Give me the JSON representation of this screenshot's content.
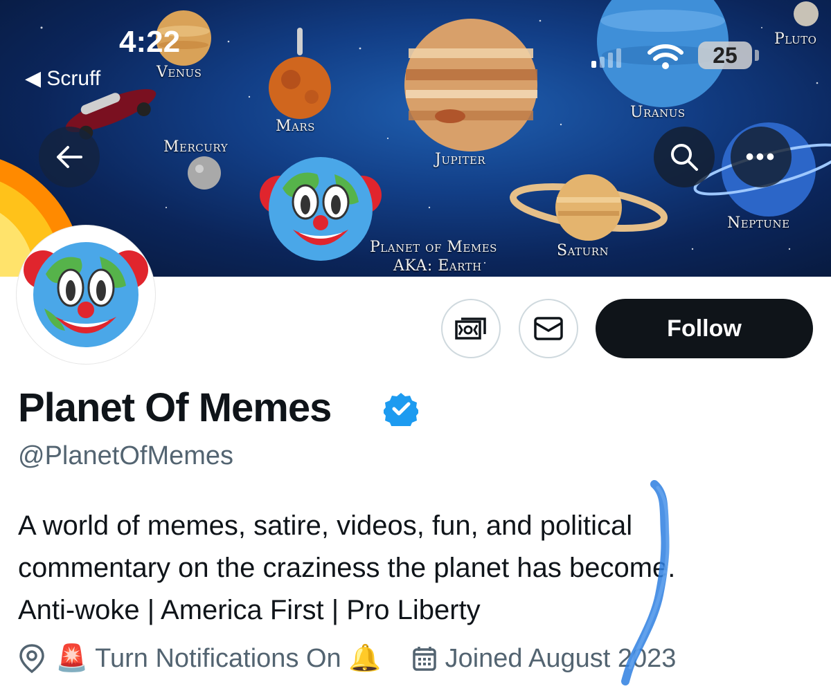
{
  "status_bar": {
    "time": "4:22",
    "back_app": "Scruff",
    "battery": "25"
  },
  "banner": {
    "planets": {
      "venus": "Venus",
      "mars": "Mars",
      "mercury": "Mercury",
      "jupiter": "Jupiter",
      "uranus": "Uranus",
      "pluto": "Pluto",
      "neptune": "Neptune",
      "saturn": "Saturn",
      "earth_line1": "Planet of Memes",
      "earth_line2": "AKA: Earth"
    }
  },
  "profile": {
    "display_name": "Planet Of Memes",
    "handle": "@PlanetOfMemes",
    "verified": true,
    "bio_line1": "A world of memes, satire, videos, fun, and political",
    "bio_line2": "commentary on the craziness the planet has become.",
    "bio_line3": "Anti-woke | America First | Pro Liberty",
    "location": "🚨 Turn Notifications On 🔔",
    "joined": "Joined August 2023"
  },
  "actions": {
    "follow_label": "Follow"
  },
  "icons": {
    "back": "arrow-left-icon",
    "search": "search-icon",
    "more": "more-icon",
    "subscribe": "money-icon",
    "message": "envelope-icon",
    "location": "location-pin-icon",
    "calendar": "calendar-icon"
  },
  "colors": {
    "follow_bg": "#0f1419",
    "verified": "#1d9bf0",
    "muted": "#536471",
    "scribble": "#2e7fe0"
  }
}
